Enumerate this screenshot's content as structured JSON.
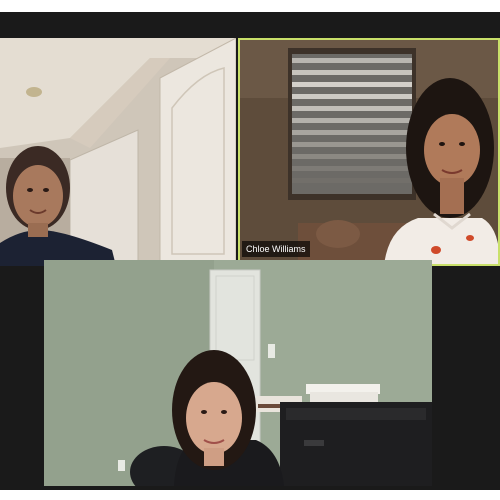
{
  "meeting": {
    "participants": [
      {
        "id": "tl",
        "name": ""
      },
      {
        "id": "tr",
        "name": "Chloe Williams"
      },
      {
        "id": "bottom",
        "name": ""
      }
    ],
    "active_speaker_color": "#c9e06a"
  }
}
